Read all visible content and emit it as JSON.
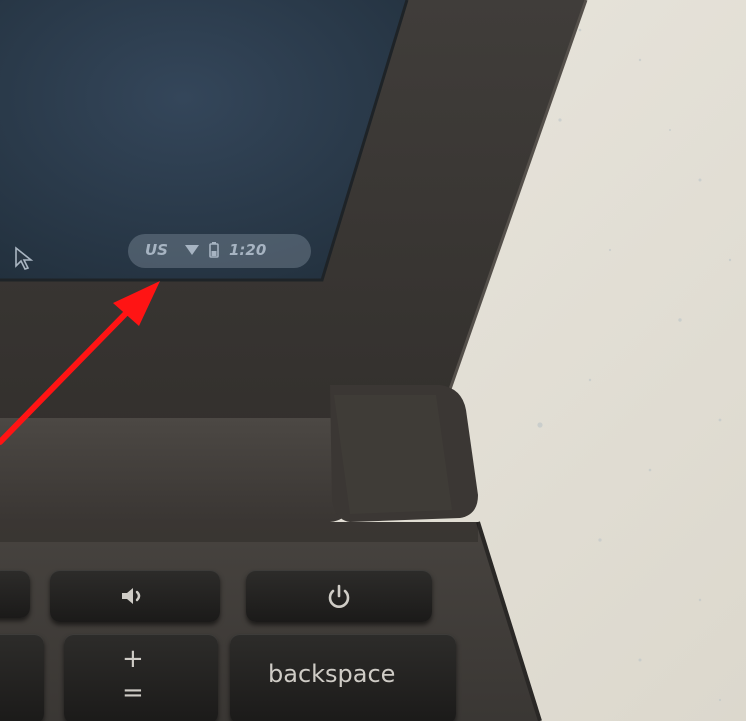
{
  "status_tray": {
    "language": "US",
    "time": "1:20",
    "wifi_icon": "wifi-icon",
    "battery_icon": "battery-icon"
  },
  "keyboard": {
    "volume_key_icon": "volume-up-icon",
    "power_key_icon": "power-icon",
    "plus_equals_top": "+",
    "plus_equals_bottom": "=",
    "backspace_label": "backspace"
  },
  "screen": {
    "cursor_icon": "mouse-cursor-icon"
  },
  "annotation": {
    "arrow_color": "#ff1414"
  },
  "colors": {
    "screen_bg": "#2c3a48",
    "bezel": "#3b3835",
    "desk": "#e9e6de"
  }
}
